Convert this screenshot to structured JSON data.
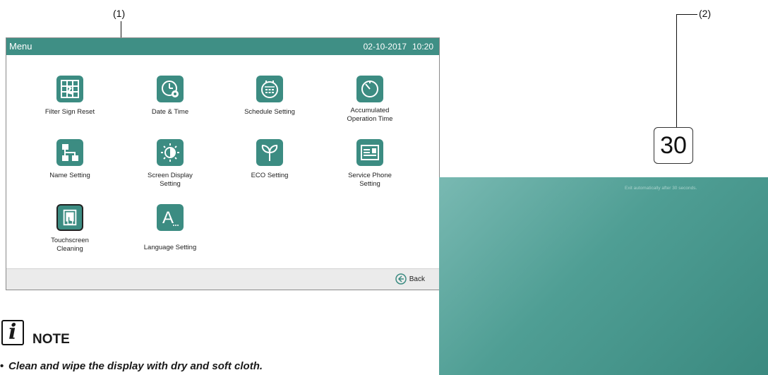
{
  "callouts": {
    "one": "(1)",
    "two": "(2)"
  },
  "menu": {
    "title": "Menu",
    "date": "02-10-2017",
    "time": "10:20",
    "items": [
      {
        "label": "Filter Sign Reset",
        "icon": "filter-grid-icon"
      },
      {
        "label": "Date & Time",
        "icon": "clock-gear-icon"
      },
      {
        "label": "Schedule Setting",
        "icon": "calendar-icon"
      },
      {
        "label": "Accumulated Operation Time",
        "icon": "dial-icon"
      },
      {
        "label": "Name Setting",
        "icon": "hierarchy-icon"
      },
      {
        "label": "Screen Display Setting",
        "icon": "brightness-icon"
      },
      {
        "label": "ECO Setting",
        "icon": "sprout-icon"
      },
      {
        "label": "Service Phone Setting",
        "icon": "contact-card-icon"
      },
      {
        "label": "Touchscreen Cleaning",
        "icon": "hand-touch-icon"
      },
      {
        "label": "Language Setting",
        "icon": "letter-a-icon"
      }
    ],
    "back_label": "Back"
  },
  "note": {
    "title": "NOTE",
    "bullet": "•",
    "text": "Clean and wipe the display with dry and soft cloth."
  },
  "cleaning_screen": {
    "countdown": "30",
    "exit_message": "Exit automatically after 30 seconds."
  },
  "colors": {
    "accent": "#3f8f85",
    "panel_gradient_start": "#79b9b2",
    "panel_gradient_end": "#3b8a80"
  }
}
